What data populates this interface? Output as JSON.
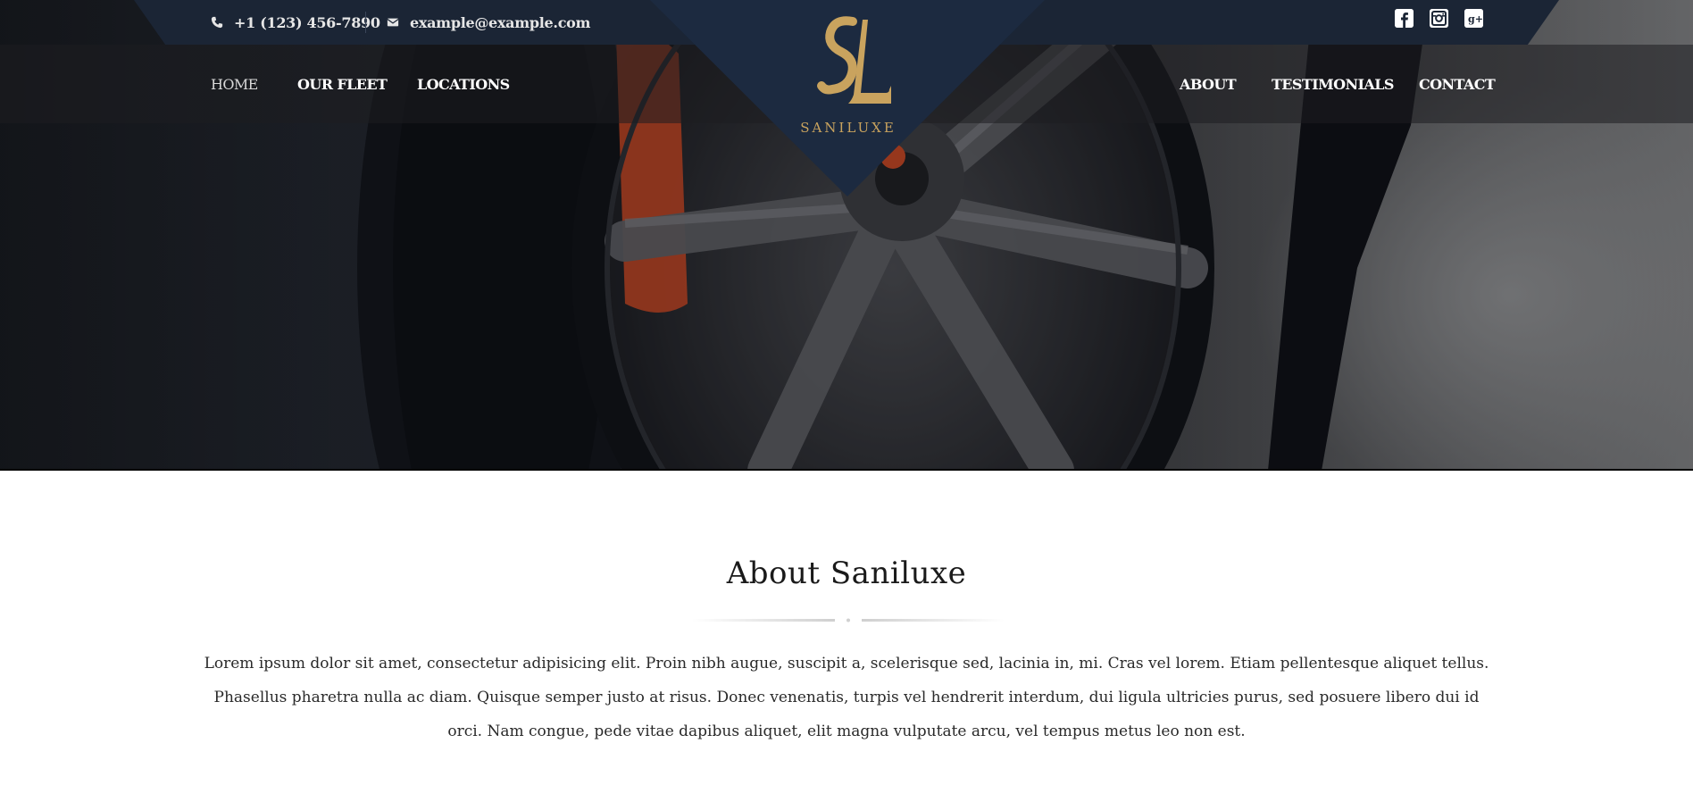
{
  "topbar": {
    "phone": "+1 (123) 456-7890",
    "email": "example@example.com",
    "phone_icon": "phone-icon",
    "email_icon": "envelope-icon",
    "social": [
      {
        "name": "facebook-icon",
        "glyph": "f"
      },
      {
        "name": "instagram-icon",
        "glyph": "◎"
      },
      {
        "name": "google-plus-icon",
        "glyph": "g+"
      }
    ]
  },
  "nav": {
    "left": [
      "HOME",
      "OUR FLEET",
      "LOCATIONS"
    ],
    "right": [
      "ABOUT",
      "TESTIMONIALS",
      "CONTACT"
    ],
    "active": "HOME"
  },
  "logo": {
    "monogram": "SL",
    "name": "SANILUXE"
  },
  "about": {
    "title": "About Saniluxe",
    "body": "Lorem ipsum dolor sit amet, consectetur adipisicing elit. Proin nibh augue, suscipit a, scelerisque sed, lacinia in, mi. Cras vel lorem. Etiam pellentesque aliquet tellus. Phasellus pharetra nulla ac diam. Quisque semper justo at risus. Donec venenatis, turpis vel hendrerit interdum, dui ligula ultricies purus, sed posuere libero dui id orci. Nam congue, pede vitae dapibus aliquet, elit magna vulputate arcu, vel tempus metus leo non est."
  },
  "colors": {
    "gold": "#c9a35e",
    "navy": "#1c2a40",
    "topbar": "#1b2535"
  }
}
